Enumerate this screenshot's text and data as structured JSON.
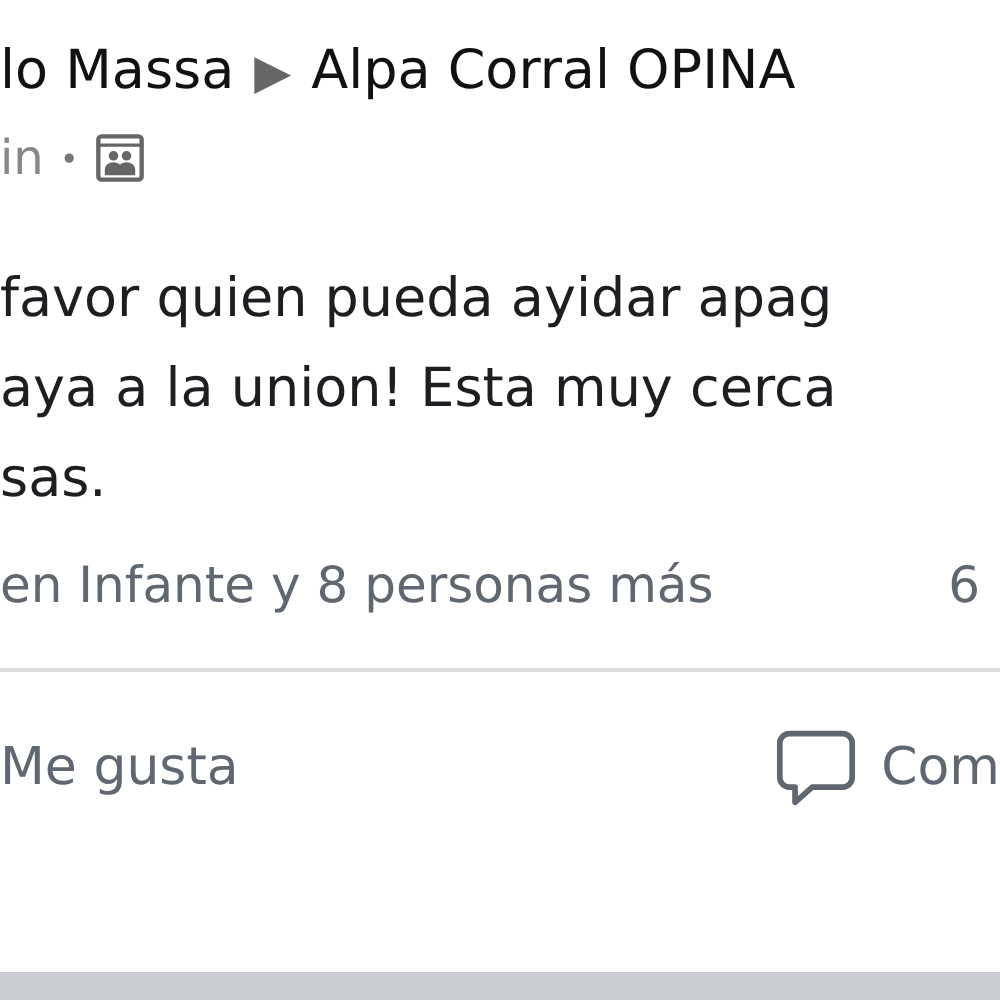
{
  "post": {
    "author": "lo Massa",
    "separator": "▶",
    "group": "Alpa Corral OPINA",
    "time": "in",
    "dot": "•",
    "text_lines": [
      "favor quien pueda ayidar apag",
      "aya a la union! Esta muy cerca",
      "sas."
    ],
    "reactions": "en Infante y 8 personas más",
    "comments_count": "6",
    "actions": [
      {
        "label": "Me gusta",
        "kind": "like"
      },
      {
        "label": "Com",
        "kind": "comment"
      }
    ]
  }
}
